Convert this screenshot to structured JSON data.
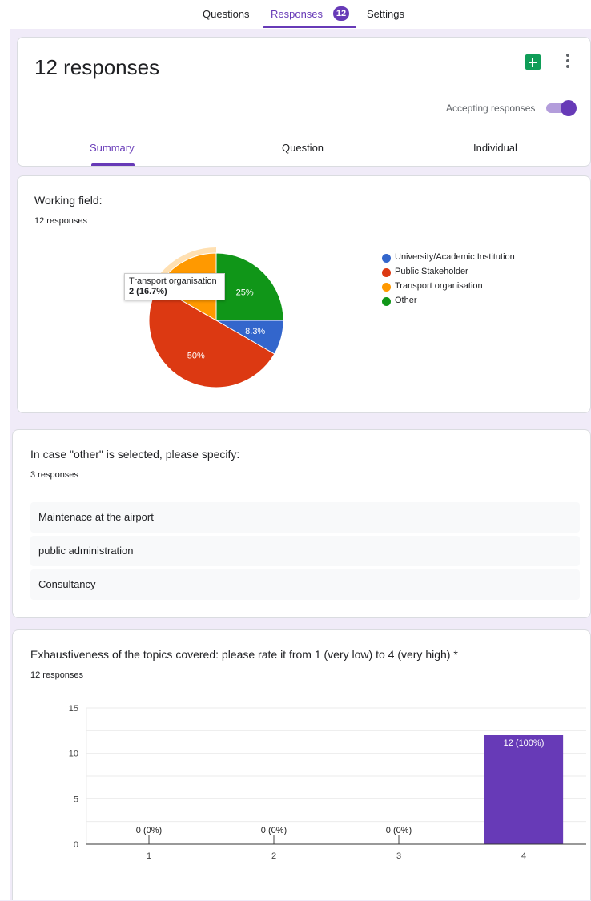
{
  "nav": {
    "tabs": [
      {
        "label": "Questions"
      },
      {
        "label": "Responses",
        "badge": "12"
      },
      {
        "label": "Settings"
      }
    ]
  },
  "header": {
    "title": "12 responses",
    "accepting_label": "Accepting responses",
    "accepting": true,
    "subtabs": [
      "Summary",
      "Question",
      "Individual"
    ],
    "active_subtab": "Summary"
  },
  "questions": {
    "working_field": {
      "title": "Working field:",
      "count": "12 responses",
      "tooltip": {
        "label": "Transport organisation",
        "value": "2 (16.7%)"
      }
    },
    "other": {
      "title": "In case \"other\" is selected, please specify:",
      "count": "3 responses",
      "answers": [
        "Maintenace at the airport",
        "public administration",
        "Consultancy"
      ]
    },
    "exhaustiveness": {
      "title": "Exhaustiveness of the topics covered: please rate it from 1 (very low) to 4 (very high) *",
      "count": "12 responses"
    }
  },
  "chart_data": [
    {
      "type": "pie",
      "title": "Working field:",
      "categories": [
        "University/Academic Institution",
        "Public Stakeholder",
        "Transport organisation",
        "Other"
      ],
      "values": [
        1,
        6,
        2,
        3
      ],
      "labels": [
        "8.3%",
        "50%",
        "",
        "25%"
      ],
      "colors": [
        "#3366cc",
        "#dc3912",
        "#ff9900",
        "#109618"
      ],
      "legend": "right",
      "highlighted": "Transport organisation"
    },
    {
      "type": "bar",
      "title": "Exhaustiveness of the topics covered: please rate it from 1 (very low) to 4 (very high) *",
      "categories": [
        "1",
        "2",
        "3",
        "4"
      ],
      "values": [
        0,
        0,
        0,
        12
      ],
      "data_labels": [
        "0 (0%)",
        "0 (0%)",
        "0 (0%)",
        "12 (100%)"
      ],
      "ylim": [
        0,
        15
      ],
      "yticks": [
        0,
        5,
        10,
        15
      ],
      "color": "#673ab7",
      "grid": true
    }
  ]
}
